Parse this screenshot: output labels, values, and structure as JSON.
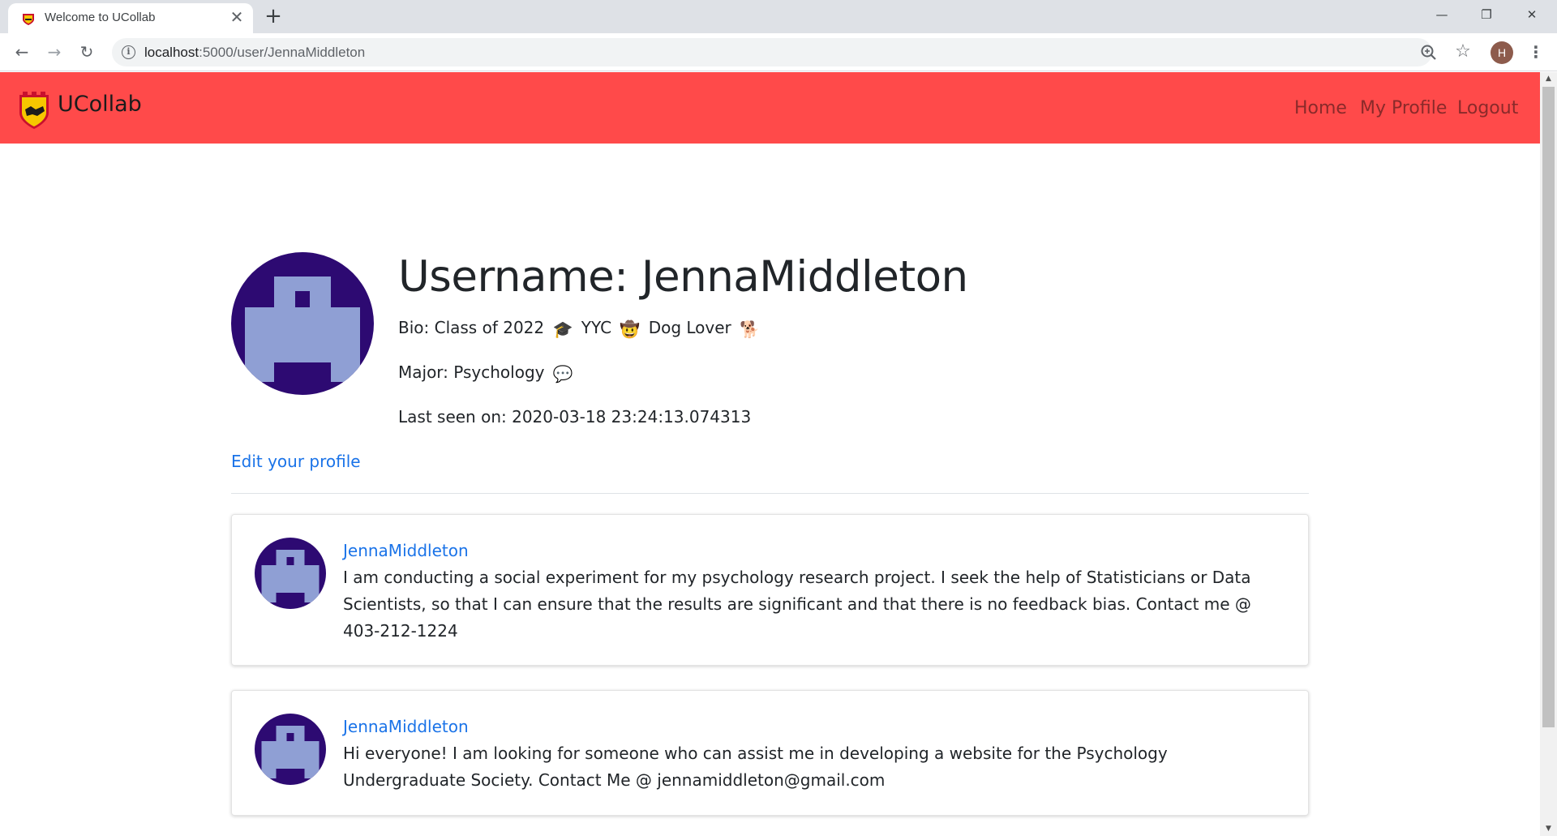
{
  "browser": {
    "tab_title": "Welcome to UCollab",
    "url_host": "localhost",
    "url_path": ":5000/user/JennaMiddleton",
    "profile_initial": "H"
  },
  "navbar": {
    "brand": "UCollab",
    "links": [
      "Home",
      "My Profile",
      "Logout"
    ],
    "background": "#ff4a4a"
  },
  "profile": {
    "username_heading": "Username: JennaMiddleton",
    "bio_prefix": "Bio: Class of 2022",
    "bio_mid": "YYC",
    "bio_suffix": "Dog Lover",
    "major": "Major: Psychology",
    "last_seen": "Last seen on: 2020-03-18 23:24:13.074313",
    "edit_link": "Edit your profile",
    "emojis": [
      "graduation-cap",
      "cowboy-face",
      "dog",
      "speech-bubble"
    ]
  },
  "posts": [
    {
      "author": "JennaMiddleton",
      "body": "I am conducting a social experiment for my psychology research project. I seek the help of Statisticians or Data Scientists, so that I can ensure that the results are significant and that there is no feedback bias. Contact me @ 403-212-1224"
    },
    {
      "author": "JennaMiddleton",
      "body": "Hi everyone! I am looking for someone who can assist me in developing a website for the Psychology Undergraduate Society. Contact Me @ jennamiddleton@gmail.com"
    }
  ],
  "colors": {
    "avatar_bg": "#2d0a72",
    "avatar_fg": "#8f9fd4",
    "link": "#1a73e8"
  }
}
